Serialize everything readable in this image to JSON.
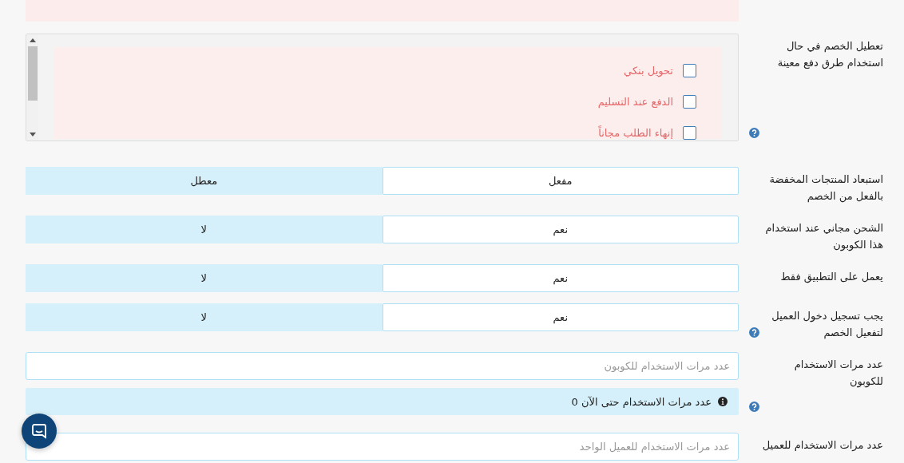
{
  "rows": [
    {
      "kind": "checklist",
      "label": "تعطيل الخصم في حال استخدام طرق دفع معينة",
      "help": true,
      "options": [
        {
          "label": "تحويل بنكي",
          "checked": false
        },
        {
          "label": "الدفع عند التسليم",
          "checked": false
        },
        {
          "label": "إنهاء الطلب مجاناً",
          "checked": false
        }
      ]
    },
    {
      "kind": "toggle",
      "label": "استبعاد المنتجات المخفضة بالفعل من الخصم",
      "help": false,
      "options": [
        {
          "label": "مفعل",
          "selected": true
        },
        {
          "label": "معطل",
          "selected": false
        }
      ]
    },
    {
      "kind": "toggle",
      "label": "الشحن مجاني عند استخدام هذا الكوبون",
      "help": false,
      "options": [
        {
          "label": "نعم",
          "selected": true
        },
        {
          "label": "لا",
          "selected": false
        }
      ]
    },
    {
      "kind": "toggle",
      "label": "يعمل على التطبيق فقط",
      "help": false,
      "options": [
        {
          "label": "نعم",
          "selected": true
        },
        {
          "label": "لا",
          "selected": false
        }
      ]
    },
    {
      "kind": "toggle",
      "label": "يجب تسجيل دخول العميل لتفعيل الخصم",
      "help": true,
      "options": [
        {
          "label": "نعم",
          "selected": true
        },
        {
          "label": "لا",
          "selected": false
        }
      ]
    },
    {
      "kind": "field",
      "label": "عدد مرات الاستخدام للكوبون",
      "help": true,
      "placeholder": "عدد مرات الاستخدام للكوبون",
      "note": "عدد مرات الاستخدام حتى الآن 0"
    },
    {
      "kind": "field",
      "label": "عدد مرات الاستخدام للعميل",
      "help": false,
      "placeholder": "عدد مرات الاستخدام للعميل الواحد"
    }
  ]
}
